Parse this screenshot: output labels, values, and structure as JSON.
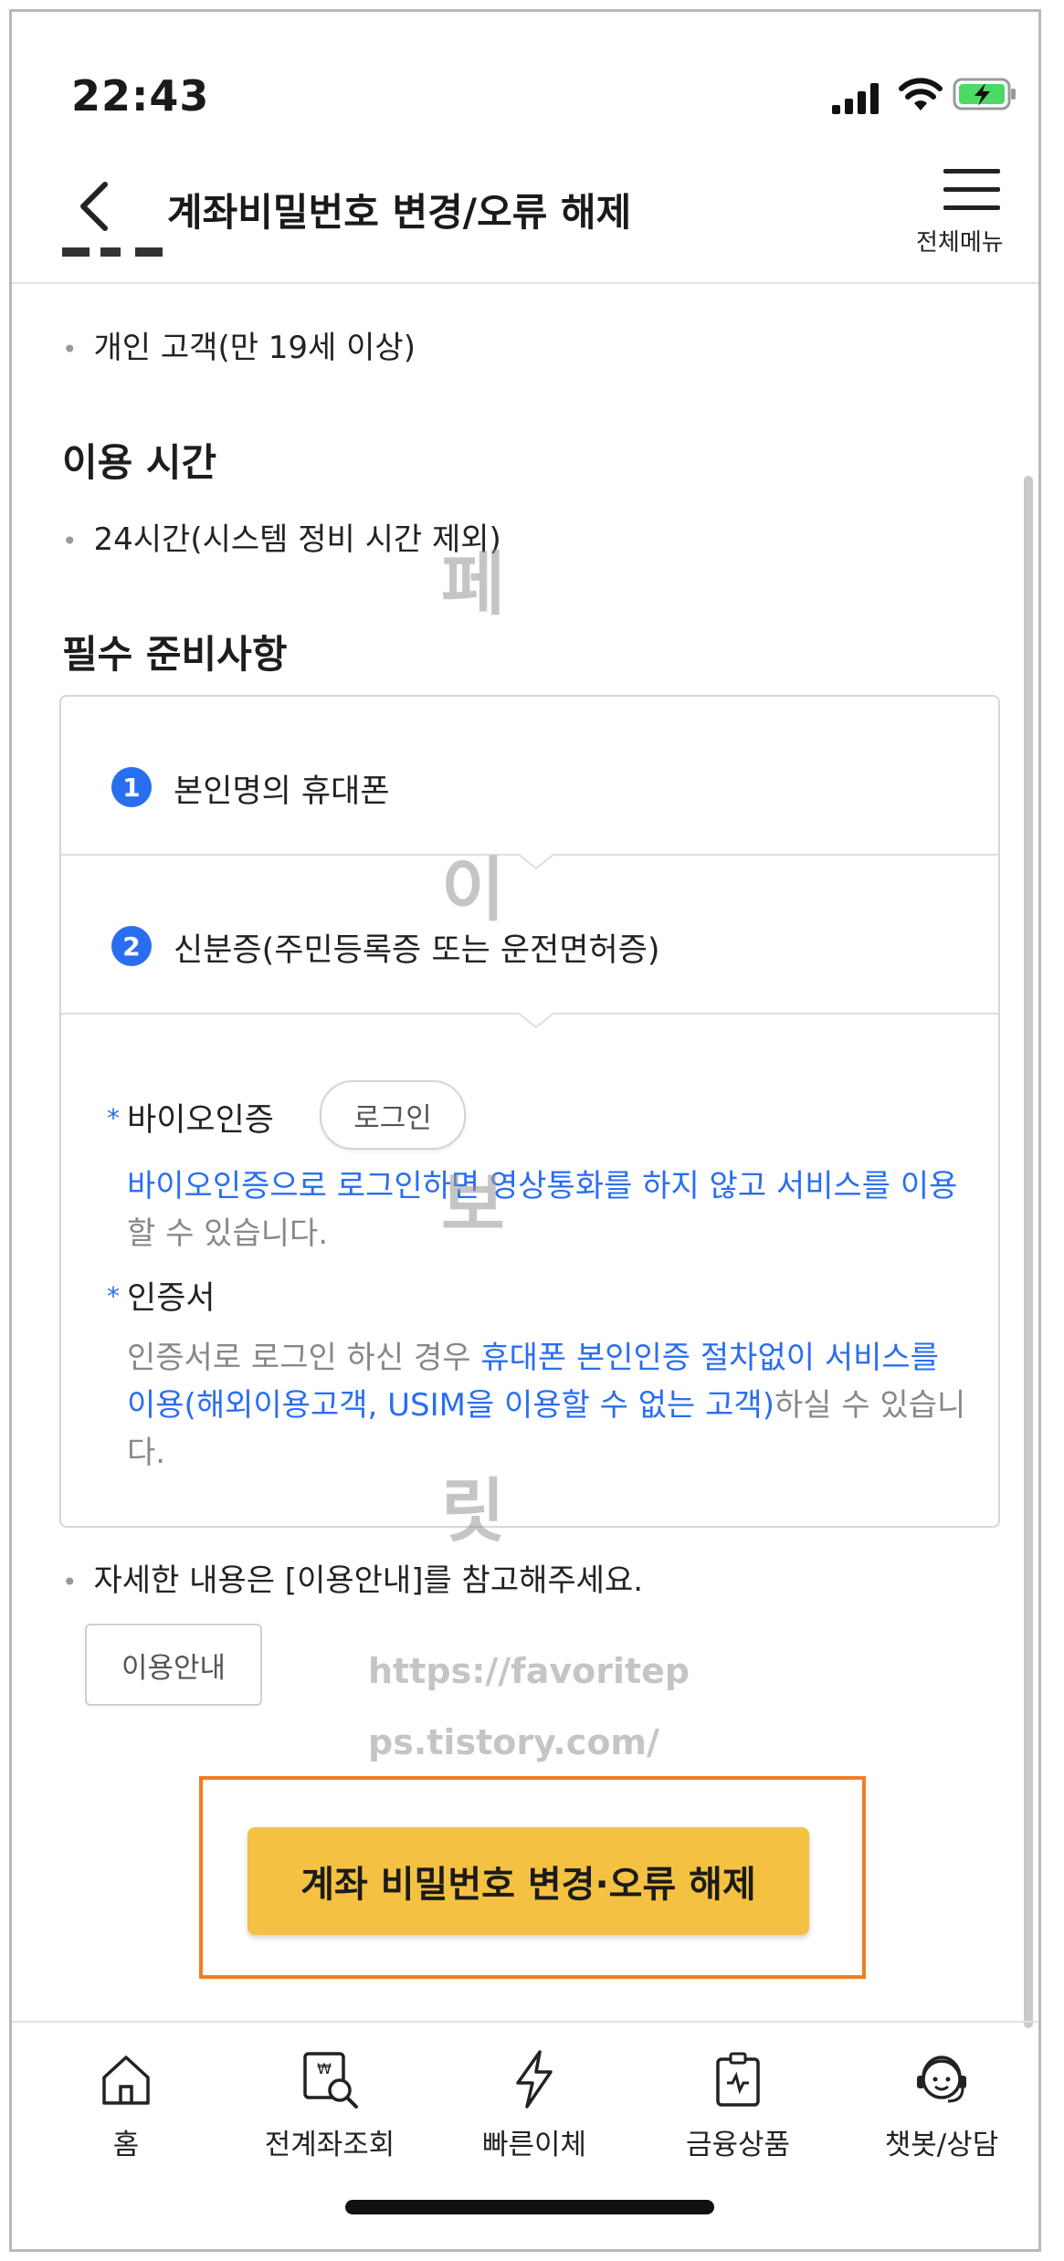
{
  "status_bar": {
    "time": "22:43"
  },
  "header": {
    "title": "계좌비밀번호 변경/오류 해제",
    "menu_label": "전체메뉴"
  },
  "content": {
    "eligibility_item": "개인 고객(만 19세 이상)",
    "hours_title": "이용 시간",
    "hours_item": "24시간(시스템 정비 시간 제외)",
    "prep_title": "필수 준비사항",
    "prep_items": [
      {
        "num": "1",
        "label": "본인명의 휴대폰"
      },
      {
        "num": "2",
        "label": "신분증(주민등록증 또는 운전면허증)"
      }
    ],
    "bio": {
      "star": "*",
      "title": "바이오인증",
      "login_button": "로그인",
      "desc_blue": "바이오인증으로 로그인하면 영상통화를 하지 않고 서비스를 이용",
      "desc_gray": "할 수 있습니다."
    },
    "cert": {
      "star": "*",
      "title": "인증서",
      "desc_gray1": "인증서로 로그인 하신 경우 ",
      "desc_blue": "휴대폰 본인인증 절차없이 서비스를 이용(해외이용고객, USIM을 이용할 수 없는 고객)",
      "desc_gray2": "하실 수 있습니다."
    },
    "detail_note": "자세한 내용은 [이용안내]를 참고해주세요.",
    "info_button": "이용안내",
    "cta_button": "계좌 비밀번호 변경·오류 해제"
  },
  "watermark": {
    "chars": [
      "페",
      "이",
      "보",
      "릿"
    ],
    "url_line1": "https://favoritep",
    "url_line2": "ps.tistory.com/"
  },
  "bottom_nav": [
    {
      "label": "홈",
      "icon": "home-icon"
    },
    {
      "label": "전계좌조회",
      "icon": "account-search-icon"
    },
    {
      "label": "빠른이체",
      "icon": "lightning-icon"
    },
    {
      "label": "금융상품",
      "icon": "financial-product-icon"
    },
    {
      "label": "챗봇/상담",
      "icon": "chatbot-icon"
    }
  ],
  "colors": {
    "accent_blue": "#2a6ef0",
    "cta_yellow": "#f5c142",
    "highlight_orange": "#f07e22"
  }
}
